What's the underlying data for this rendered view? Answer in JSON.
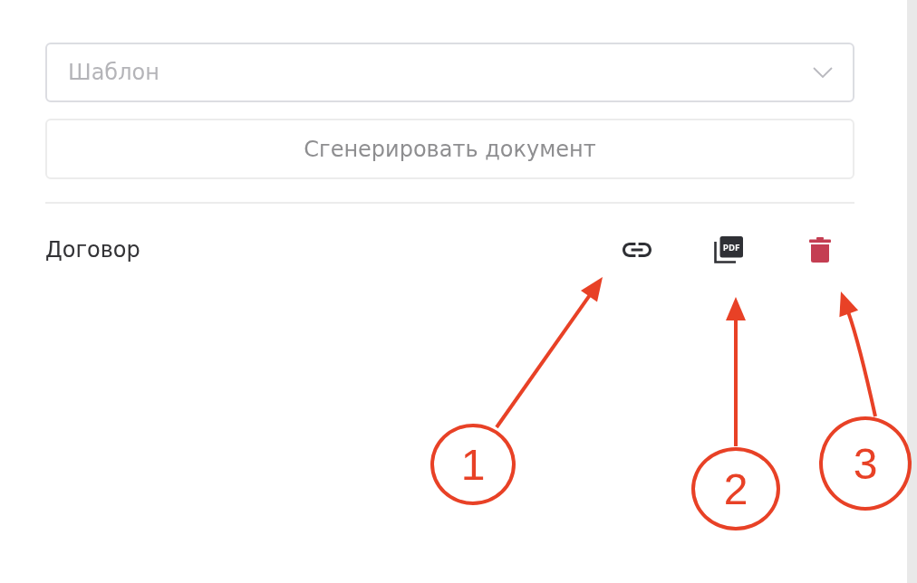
{
  "template_select": {
    "placeholder": "Шаблон"
  },
  "generate_button": {
    "label": "Сгенерировать документ"
  },
  "documents": [
    {
      "name": "Договор",
      "actions": [
        {
          "kind": "link"
        },
        {
          "kind": "pdf",
          "label": "PDF"
        },
        {
          "kind": "delete"
        }
      ]
    }
  ],
  "annotations": [
    {
      "number": "1"
    },
    {
      "number": "2"
    },
    {
      "number": "3"
    }
  ]
}
